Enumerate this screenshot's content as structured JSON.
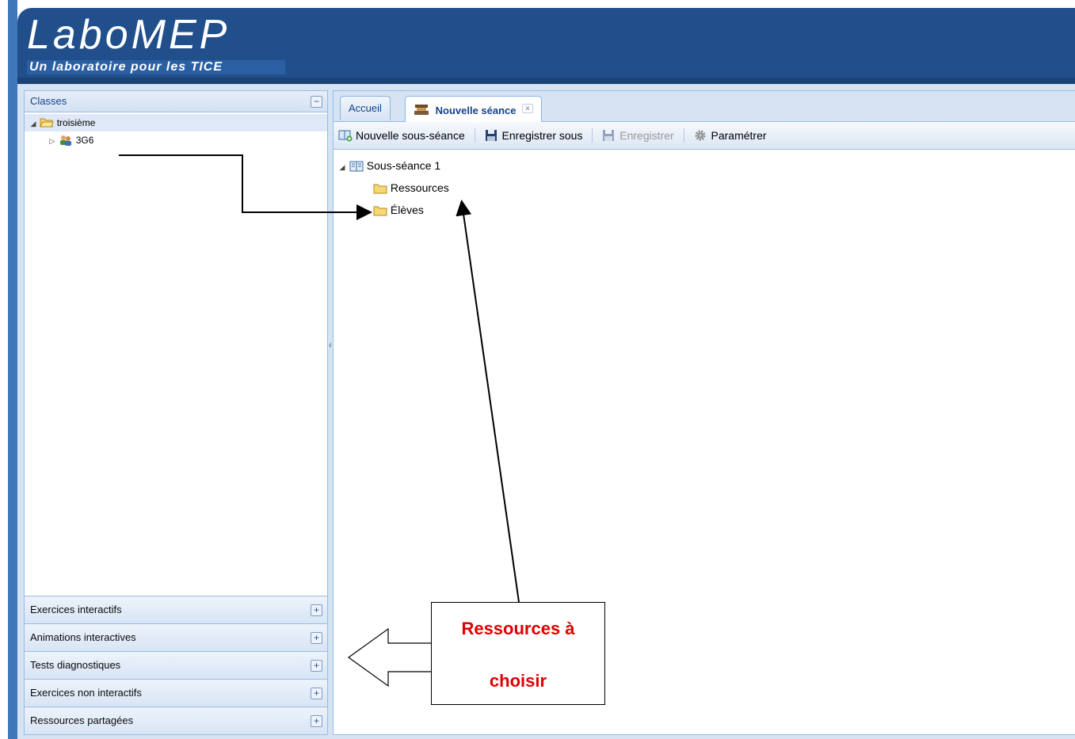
{
  "header": {
    "logo_text": "LaboMEP",
    "logo_tagline": "Un laboratoire pour les TICE"
  },
  "left_panel": {
    "title": "Classes",
    "collapse_icon": "minus-icon",
    "tree": {
      "root_label": "troisième",
      "child_label": "3G6"
    },
    "accordion": [
      {
        "label": "Exercices interactifs",
        "icon": "plus-icon"
      },
      {
        "label": "Animations interactives",
        "icon": "plus-icon"
      },
      {
        "label": "Tests diagnostiques",
        "icon": "plus-icon"
      },
      {
        "label": "Exercices non interactifs",
        "icon": "plus-icon"
      },
      {
        "label": "Ressources partagées",
        "icon": "plus-icon"
      }
    ]
  },
  "tabs": {
    "home": "Accueil",
    "active": "Nouvelle séance",
    "close_glyph": "✕"
  },
  "toolbar": {
    "new_subsession": "Nouvelle sous-séance",
    "save_as": "Enregistrer sous",
    "save": "Enregistrer",
    "settings": "Paramétrer"
  },
  "session_tree": {
    "root": "Sous-séance 1",
    "items": [
      "Ressources",
      "Élèves"
    ]
  },
  "annotation": {
    "line1": "Ressources à",
    "line2": "choisir",
    "color": "#e00000"
  },
  "colors": {
    "header": "#214f8b",
    "panel_border": "#99bbe8",
    "app_background": "#d5e3f3"
  }
}
